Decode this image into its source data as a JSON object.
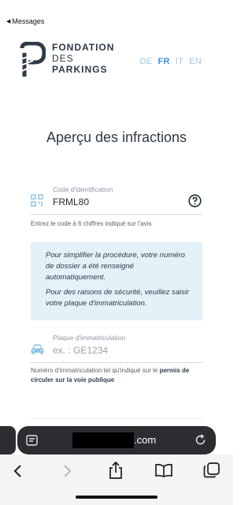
{
  "status": {
    "back_label": "Messages"
  },
  "logo": {
    "line1": "FONDATION",
    "line2": "DES",
    "line3": "PARKINGS"
  },
  "languages": [
    {
      "code": "DE",
      "active": false
    },
    {
      "code": "FR",
      "active": true
    },
    {
      "code": "IT",
      "active": false
    },
    {
      "code": "EN",
      "active": false
    }
  ],
  "page_title": "Aperçu des infractions",
  "id_field": {
    "label": "Code d'identification",
    "value": "FRML80",
    "help": "Entrez le code à 6 chiffres indiqué sur l'avis"
  },
  "info_box": {
    "p1": "Pour simplifier la procédure, votre numéro de dossier a été renseigné automatiquement.",
    "p2": "Pour des raisons de sécurité, veuillez saisir votre plaque d'immatriculation."
  },
  "plate_field": {
    "label": "Plaque d'immatriculation",
    "placeholder": "ex. : GE1234",
    "help_prefix": "Numéro d'immatriculation tel qu'indiqué sur le ",
    "help_bold": "permis de circuler sur la voie publique"
  },
  "browser": {
    "url_suffix": ".com"
  },
  "colors": {
    "accent": "#3b8fd9",
    "info_bg": "#e3f1f9",
    "text": "#33414e"
  }
}
